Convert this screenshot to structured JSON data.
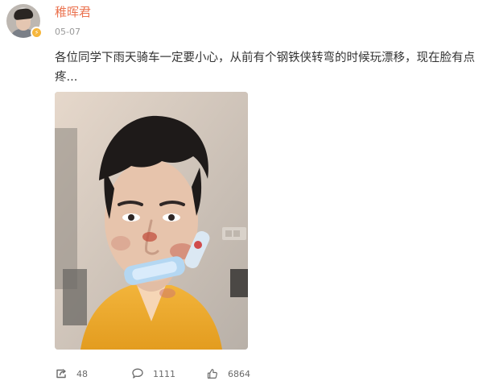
{
  "user": {
    "name": "稚晖君",
    "date": "05-07",
    "verified_badge": "⚡"
  },
  "post": {
    "text": "各位同学下雨天骑车一定要小心，从前有个钢铁侠转弯的时候玩漂移，现在脸有点疼..."
  },
  "stats": {
    "shares": "48",
    "comments": "1111",
    "likes": "6864"
  },
  "icons": {
    "share": "share-icon",
    "comment": "comment-icon",
    "like": "thumbs-up-icon"
  },
  "colors": {
    "username": "#eb7350",
    "text": "#333333",
    "muted": "#999999"
  }
}
